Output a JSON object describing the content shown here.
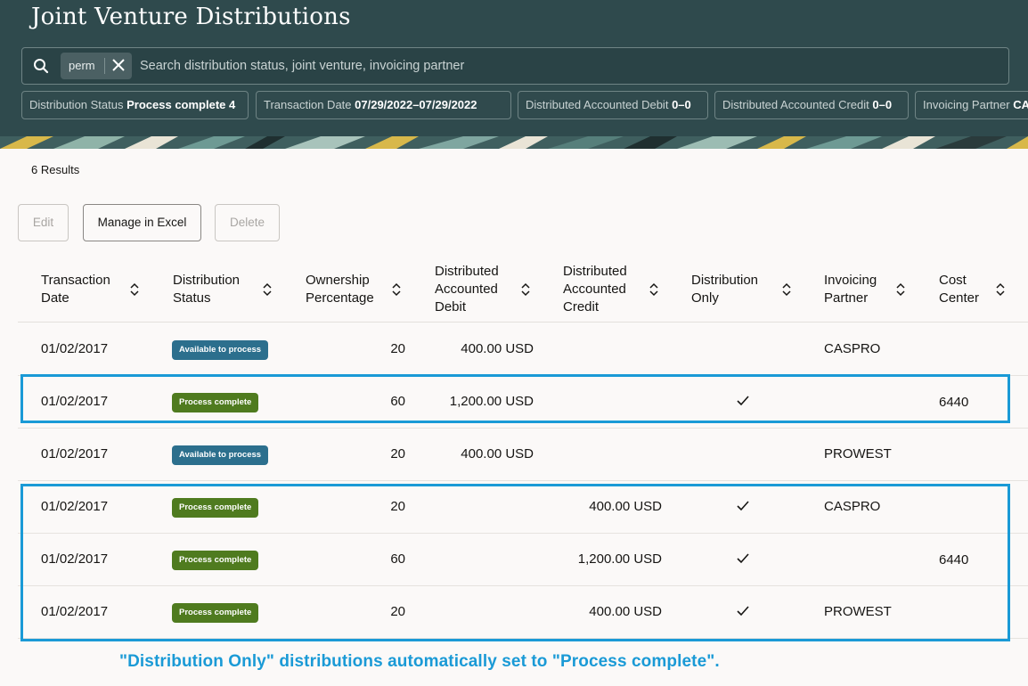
{
  "page": {
    "title": "Joint Venture Distributions"
  },
  "search": {
    "chip_label": "perm",
    "placeholder": "Search distribution status, joint venture, invoicing partner"
  },
  "filters": [
    {
      "label": "Distribution Status",
      "value": "Process complete",
      "count": "4"
    },
    {
      "label": "Transaction Date",
      "value": "07/29/2022–07/29/2022"
    },
    {
      "label": "Distributed Accounted Debit",
      "value": "0–0"
    },
    {
      "label": "Distributed Accounted Credit",
      "value": "0–0"
    },
    {
      "label": "Invoicing Partner",
      "value": "CA"
    }
  ],
  "results_text": "6 Results",
  "toolbar": {
    "edit_label": "Edit",
    "excel_label": "Manage in Excel",
    "delete_label": "Delete"
  },
  "columns": [
    {
      "line1": "Transaction",
      "line2": "Date",
      "line3": ""
    },
    {
      "line1": "Distribution",
      "line2": "Status",
      "line3": ""
    },
    {
      "line1": "Ownership",
      "line2": "Percentage",
      "line3": ""
    },
    {
      "line1": "Distributed",
      "line2": "Accounted",
      "line3": "Debit"
    },
    {
      "line1": "Distributed",
      "line2": "Accounted",
      "line3": "Credit"
    },
    {
      "line1": "Distribution",
      "line2": "Only",
      "line3": ""
    },
    {
      "line1": "Invoicing",
      "line2": "Partner",
      "line3": ""
    },
    {
      "line1": "Cost",
      "line2": "Center",
      "line3": ""
    }
  ],
  "rows": [
    {
      "date": "01/02/2017",
      "status": "Available to process",
      "pct": "20",
      "debit": "400.00 USD",
      "credit": "",
      "dist_only": false,
      "partner": "CASPRO",
      "cost_center": ""
    },
    {
      "date": "01/02/2017",
      "status": "Process complete",
      "pct": "60",
      "debit": "1,200.00 USD",
      "credit": "",
      "dist_only": true,
      "partner": "",
      "cost_center": "6440"
    },
    {
      "date": "01/02/2017",
      "status": "Available to process",
      "pct": "20",
      "debit": "400.00 USD",
      "credit": "",
      "dist_only": false,
      "partner": "PROWEST",
      "cost_center": ""
    },
    {
      "date": "01/02/2017",
      "status": "Process complete",
      "pct": "20",
      "debit": "",
      "credit": "400.00 USD",
      "dist_only": true,
      "partner": "CASPRO",
      "cost_center": ""
    },
    {
      "date": "01/02/2017",
      "status": "Process complete",
      "pct": "60",
      "debit": "",
      "credit": "1,200.00 USD",
      "dist_only": true,
      "partner": "",
      "cost_center": "6440"
    },
    {
      "date": "01/02/2017",
      "status": "Process complete",
      "pct": "20",
      "debit": "",
      "credit": "400.00 USD",
      "dist_only": true,
      "partner": "PROWEST",
      "cost_center": ""
    }
  ],
  "status_colors": {
    "Available to process": "#2c6f8d",
    "Process complete": "#4f7b1f"
  },
  "annotation": {
    "caption": "\"Distribution Only\" distributions automatically set to \"Process complete\".",
    "color": "#1a9ad6"
  }
}
